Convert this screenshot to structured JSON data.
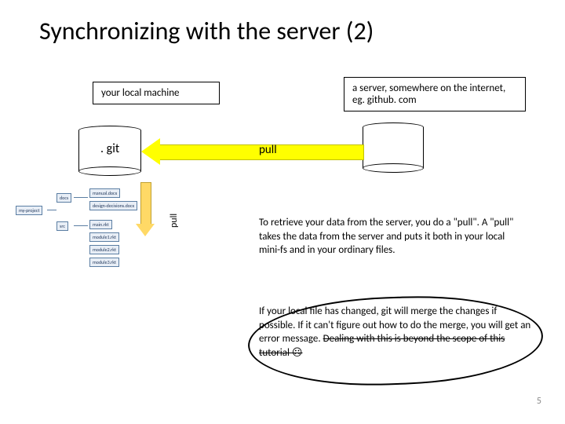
{
  "title": "Synchronizing with the server (2)",
  "local_box": "your local machine",
  "server_box": "a server, somewhere on the internet, eg. github. com",
  "git_label": ". git",
  "pull_label": "pull",
  "pull_vert": "pull",
  "tree": {
    "root": "my-project",
    "docs": "docs",
    "src": "src",
    "leaves": [
      "manual.docx",
      "design-decisions.docx",
      "main.rkt",
      "module1.rkt",
      "module2.rkt",
      "module3.rkt"
    ]
  },
  "para1": "To retrieve your data from the server, you do a \"pull\". A \"pull\" takes the data from the server and puts it both in your local mini-fs and in your ordinary files.",
  "para2_a": "If your local file has changed, git will merge the changes if possible. If it can't figure out how to do the merge, you will get an error message. ",
  "para2_strike": "Dealing with this is beyond the scope of this tutorial ☹",
  "page": "5"
}
